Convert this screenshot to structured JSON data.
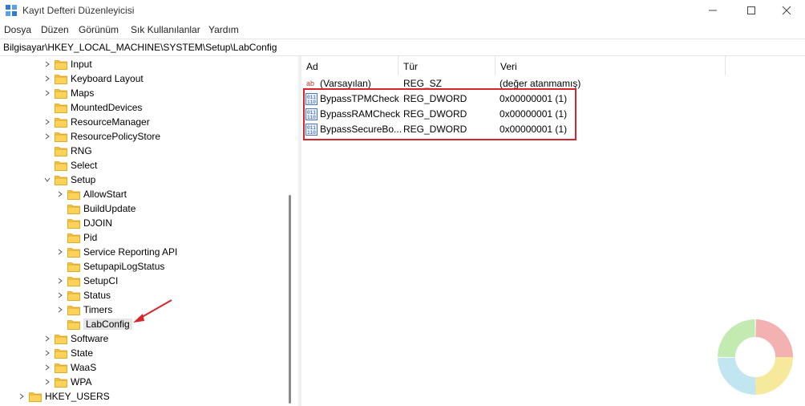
{
  "window": {
    "title": "Kayıt Defteri Düzenleyicisi",
    "minimize_icon": "minimize-icon",
    "maximize_icon": "maximize-icon",
    "close_icon": "close-icon"
  },
  "menu": {
    "items": [
      "Dosya",
      "Düzen",
      "Görünüm",
      "Sık Kullanılanlar",
      "Yardım"
    ]
  },
  "address": {
    "path": "Bilgisayar\\HKEY_LOCAL_MACHINE\\SYSTEM\\Setup\\LabConfig"
  },
  "tree": {
    "items": [
      {
        "label": "Input",
        "expander": "collapsed"
      },
      {
        "label": "Keyboard Layout",
        "expander": "collapsed"
      },
      {
        "label": "Maps",
        "expander": "collapsed"
      },
      {
        "label": "MountedDevices",
        "expander": "none"
      },
      {
        "label": "ResourceManager",
        "expander": "collapsed"
      },
      {
        "label": "ResourcePolicyStore",
        "expander": "collapsed"
      },
      {
        "label": "RNG",
        "expander": "none"
      },
      {
        "label": "Select",
        "expander": "none"
      },
      {
        "label": "Setup",
        "expander": "expanded"
      },
      {
        "label": "AllowStart",
        "expander": "collapsed"
      },
      {
        "label": "BuildUpdate",
        "expander": "none"
      },
      {
        "label": "DJOIN",
        "expander": "none"
      },
      {
        "label": "Pid",
        "expander": "none"
      },
      {
        "label": "Service Reporting API",
        "expander": "collapsed"
      },
      {
        "label": "SetupapiLogStatus",
        "expander": "none"
      },
      {
        "label": "SetupCI",
        "expander": "collapsed"
      },
      {
        "label": "Status",
        "expander": "collapsed"
      },
      {
        "label": "Timers",
        "expander": "collapsed"
      },
      {
        "label": "LabConfig",
        "expander": "none",
        "selected": true
      },
      {
        "label": "Software",
        "expander": "collapsed"
      },
      {
        "label": "State",
        "expander": "collapsed"
      },
      {
        "label": "WaaS",
        "expander": "collapsed"
      },
      {
        "label": "WPA",
        "expander": "collapsed"
      },
      {
        "label": "HKEY_USERS",
        "expander": "collapsed"
      }
    ]
  },
  "list": {
    "columns": [
      "Ad",
      "Tür",
      "Veri"
    ],
    "rows": [
      {
        "name": "(Varsayılan)",
        "type": "REG_SZ",
        "data": "(değer atanmamış)",
        "icon": "string-value-icon"
      },
      {
        "name": "BypassTPMCheck",
        "type": "REG_DWORD",
        "data": "0x00000001 (1)",
        "icon": "binary-value-icon"
      },
      {
        "name": "BypassRAMCheck",
        "type": "REG_DWORD",
        "data": "0x00000001 (1)",
        "icon": "binary-value-icon"
      },
      {
        "name": "BypassSecureBo...",
        "type": "REG_DWORD",
        "data": "0x00000001 (1)",
        "icon": "binary-value-icon"
      }
    ]
  },
  "colors": {
    "folder": "#f6c444",
    "highlight": "#d6262b",
    "selection": "#e5e5e5"
  }
}
